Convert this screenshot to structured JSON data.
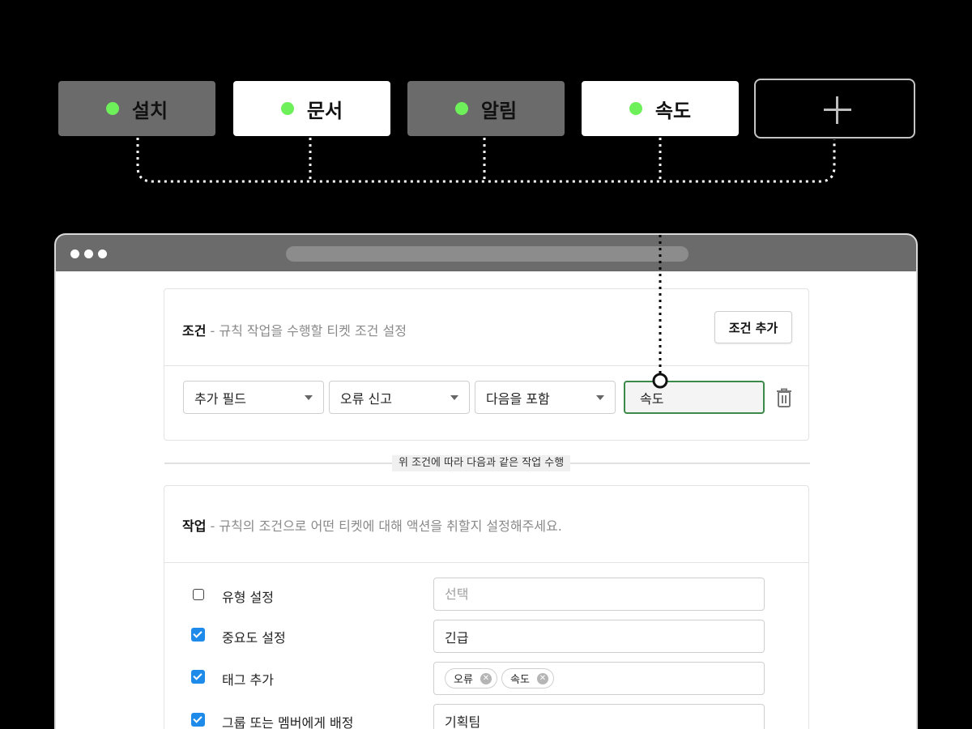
{
  "tags": [
    {
      "label": "설치",
      "style": "dark"
    },
    {
      "label": "문서",
      "style": "light"
    },
    {
      "label": "알림",
      "style": "dark"
    },
    {
      "label": "속도",
      "style": "light"
    }
  ],
  "add_tag_icon": "plus-icon",
  "colors": {
    "status_dot": "#6ef05a",
    "accent_green": "#3c8a4a",
    "checkbox_blue": "#1e8bea"
  },
  "conditions": {
    "title": "조건",
    "description": "- 규칙 작업을 수행할 티켓 조건 설정",
    "add_button": "조건 추가",
    "field_select": "추가 필드",
    "value_select": "오류 신고",
    "operator_select": "다음을 포함",
    "value_input": "속도",
    "delete_icon": "trash-icon"
  },
  "divider_text": "위 조건에 따라 다음과 같은 작업 수행",
  "actions": {
    "title": "작업",
    "description": "- 규칙의 조건으로 어떤 티켓에 대해 액션을 취할지 설정해주세요.",
    "rows": [
      {
        "label": "유형 설정",
        "checked": false,
        "placeholder": "선택",
        "value": ""
      },
      {
        "label": "중요도 설정",
        "checked": true,
        "value": "긴급"
      },
      {
        "label": "태그 추가",
        "checked": true,
        "chips": [
          "오류",
          "속도"
        ]
      },
      {
        "label": "그룹 또는 멤버에게 배정",
        "checked": true,
        "value": "기획팀"
      }
    ]
  }
}
